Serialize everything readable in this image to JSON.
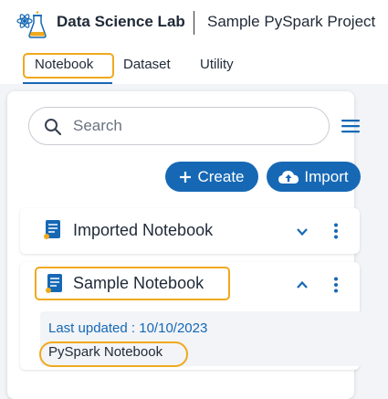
{
  "header": {
    "app_title": "Data Science Lab",
    "project_title": "Sample PySpark Project",
    "logo_icon": "flask-atom-icon"
  },
  "tabs": [
    {
      "label": "Notebook",
      "active": true
    },
    {
      "label": "Dataset",
      "active": false
    },
    {
      "label": "Utility",
      "active": false
    }
  ],
  "search": {
    "placeholder": "Search",
    "value": ""
  },
  "actions": {
    "create_label": "Create",
    "import_label": "Import"
  },
  "notebooks": [
    {
      "name": "Imported Notebook",
      "expanded": false
    },
    {
      "name": "Sample Notebook",
      "expanded": true,
      "last_updated": "Last updated : 10/10/2023",
      "type": "PySpark Notebook"
    }
  ],
  "colors": {
    "accent": "#1668b5",
    "highlight": "#f0a91e",
    "panel_bg": "#f2f4f7"
  }
}
